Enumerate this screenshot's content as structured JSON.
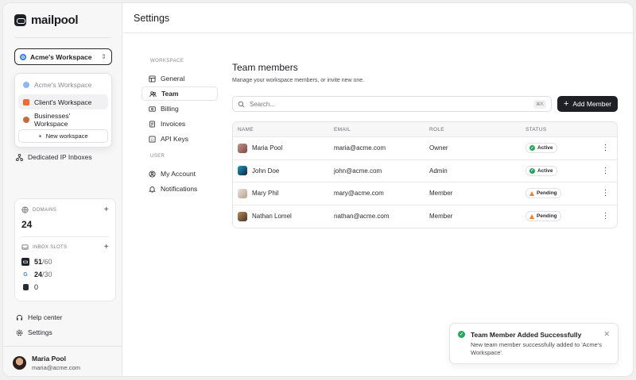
{
  "app": {
    "logo_text": "mailpool"
  },
  "header": {
    "title": "Settings"
  },
  "workspace": {
    "selected": "Acme's Workspace",
    "selected_color": "#2f7cf6",
    "options": [
      {
        "label": "Acme's Workspace",
        "color": "#5a9cf5",
        "state": "dim"
      },
      {
        "label": "Client's Workspace",
        "color": "#f46a2e",
        "state": "highlighted"
      },
      {
        "label": "Businesses' Workspace",
        "color": "#e2642b",
        "state": "normal"
      }
    ],
    "new_label": "New workspace"
  },
  "sidebar": {
    "dedicated_label": "Dedicated IP Inboxes",
    "help_label": "Help center",
    "settings_label": "Settings"
  },
  "stats": {
    "domains_label": "DOMAINS",
    "domains_value": "24",
    "inbox_label": "INBOX SLOTS",
    "slots": [
      {
        "used": "51",
        "total": "/60",
        "icon": "mailpool-icon"
      },
      {
        "used": "24",
        "total": "/30",
        "icon": "google-icon"
      },
      {
        "used": "0",
        "total": "",
        "icon": "microsoft-icon"
      }
    ]
  },
  "user": {
    "name": "Maria Pool",
    "email": "maria@acme.com"
  },
  "settings_nav": {
    "workspace_section": "WORKSPACE",
    "user_section": "USER",
    "items": {
      "general": "General",
      "team": "Team",
      "billing": "Billing",
      "invoices": "Invoices",
      "api_keys": "API Keys",
      "my_account": "My Account",
      "notifications": "Notifications"
    }
  },
  "team": {
    "title": "Team members",
    "subtitle": "Manage your workspace members, or invite new one.",
    "search_placeholder": "Search...",
    "search_shortcut": "⌘K",
    "add_button": "Add Member",
    "columns": [
      "NAME",
      "EMAIL",
      "ROLE",
      "STATUS"
    ],
    "rows": [
      {
        "name": "Maria Pool",
        "email": "maria@acme.com",
        "role": "Owner",
        "status": "Active"
      },
      {
        "name": "John Doe",
        "email": "john@acme.com",
        "role": "Admin",
        "status": "Active"
      },
      {
        "name": "Mary Phil",
        "email": "mary@acme.com",
        "role": "Member",
        "status": "Pending"
      },
      {
        "name": "Nathan Lomel",
        "email": "nathan@acme.com",
        "role": "Member",
        "status": "Pending"
      }
    ]
  },
  "toast": {
    "title": "Team Member Added Successfully",
    "body": "New team member successfully added to 'Acme's Workspace'."
  }
}
